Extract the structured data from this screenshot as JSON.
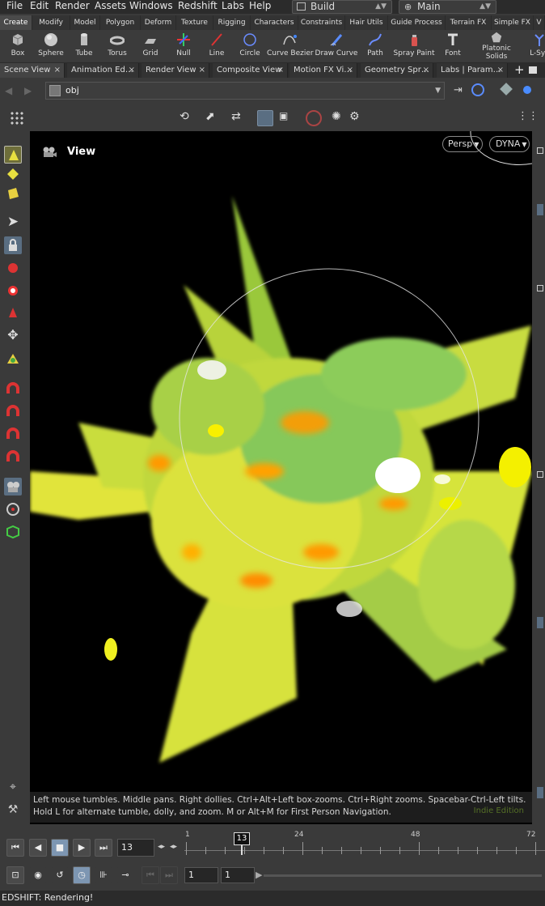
{
  "menubar": {
    "items": [
      "File",
      "Edit",
      "Render",
      "Assets",
      "Windows",
      "Redshift",
      "Labs",
      "Help"
    ],
    "desktop": "Build",
    "context": "Main"
  },
  "shelf_tabs": [
    "Create",
    "Modify",
    "Model",
    "Polygon",
    "Deform",
    "Texture",
    "Rigging",
    "Characters",
    "Constraints",
    "Hair Utils",
    "Guide Process",
    "Terrain FX",
    "Simple FX",
    "V"
  ],
  "shelf_tools": [
    "Box",
    "Sphere",
    "Tube",
    "Torus",
    "Grid",
    "Null",
    "Line",
    "Circle",
    "Curve Bezier",
    "Draw Curve",
    "Path",
    "Spray Paint",
    "Font",
    "Platonic Solids",
    "L-Sys"
  ],
  "pane_tabs": [
    "Scene View",
    "Animation Ed…",
    "Render View",
    "Composite View",
    "Motion FX Vi…",
    "Geometry Spr…",
    "Labs | Param…"
  ],
  "path": {
    "value": "obj"
  },
  "viewport": {
    "label": "View",
    "camera": "Persp",
    "display": "DYNA",
    "hint": "Left mouse tumbles. Middle pans. Right dollies. Ctrl+Alt+Left box-zooms. Ctrl+Right zooms. Spacebar-Ctrl-Left tilts. Hold L for alternate tumble, dolly, and zoom. M or Alt+M for First Person Navigation.",
    "edition": "Indie Edition"
  },
  "timeline": {
    "current_frame": "13",
    "frame_field": "13",
    "ticks": [
      "1",
      "24",
      "48",
      "72"
    ],
    "range_start": "1",
    "range_end": "1"
  },
  "status": {
    "text": "EDSHIFT: Rendering!"
  },
  "colors": {
    "accent": "#f0f040",
    "brand_green": "#7ad060",
    "orange": "#ff9a00",
    "status_bg": "#2b2b2b"
  }
}
